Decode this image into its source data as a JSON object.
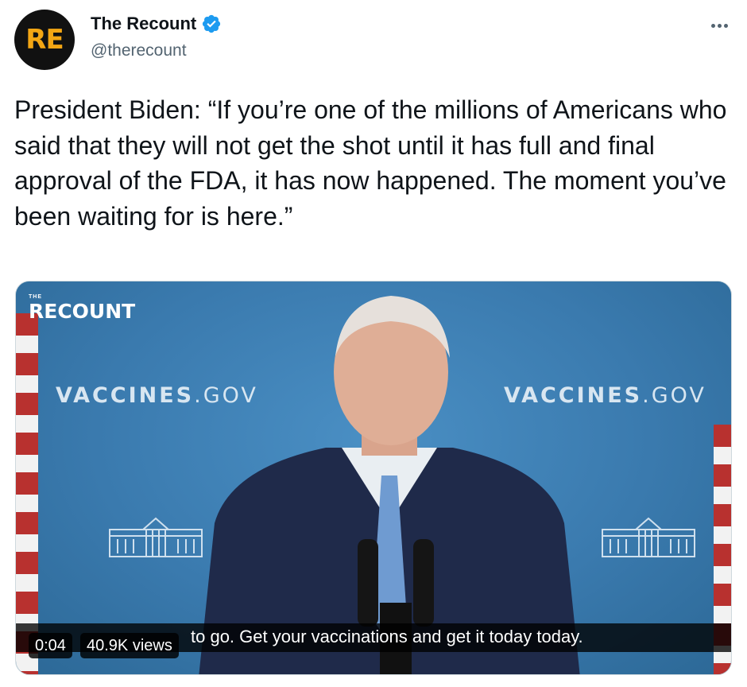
{
  "author": {
    "display_name": "The Recount",
    "handle": "@therecount",
    "avatar_text": "RE",
    "verified_icon": "verified-badge-icon",
    "avatar_bg": "#111111",
    "avatar_fg": "#f3a614"
  },
  "more_icon": "ellipsis-icon",
  "tweet": {
    "text": "President Biden: “If you’re one of the millions of Americans who said that they will not get the shot until it has full and final approval of the FDA, it has now happened. The moment you’ve been waiting for is here.”"
  },
  "video": {
    "watermark_small": "THE",
    "watermark_main": "RECOUNT",
    "backdrop_left_bold": "VACCINES",
    "backdrop_left_light": ".GOV",
    "backdrop_right_bold": "VACCINES",
    "backdrop_right_light": ".GOV",
    "caption": "to go. Get your vaccinations and get it today today.",
    "time": "0:04",
    "views": "40.9K views"
  },
  "colors": {
    "verified": "#1d9bf0",
    "text_primary": "#0f1419",
    "text_secondary": "#536471"
  }
}
